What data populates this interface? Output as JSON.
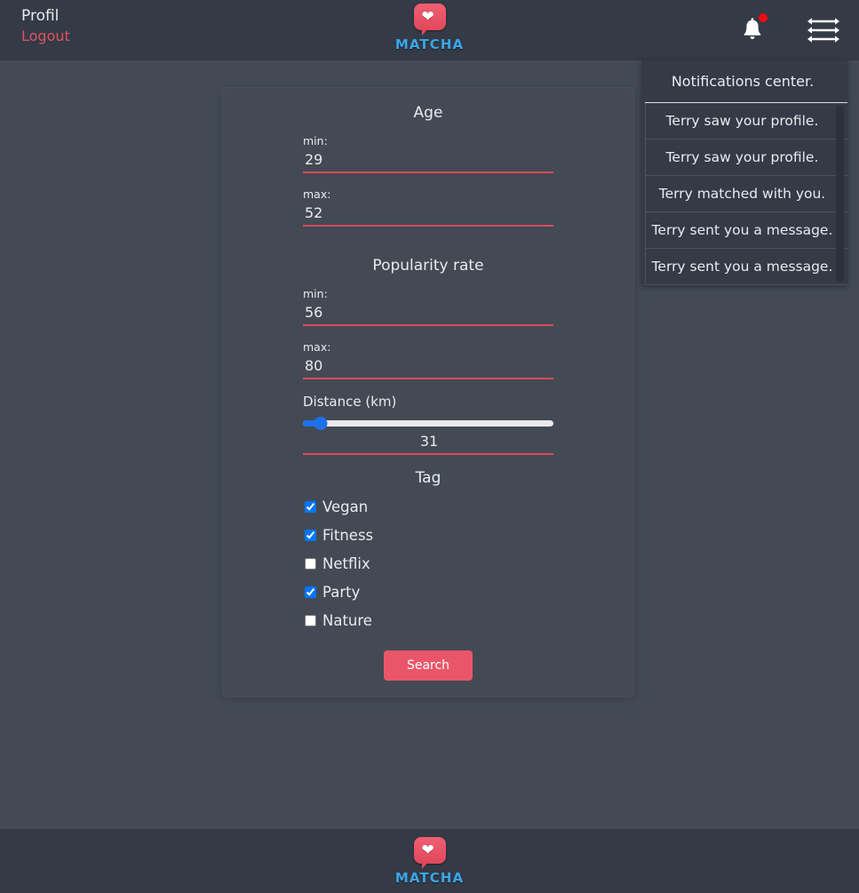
{
  "header": {
    "profile_label": "Profil",
    "logout_label": "Logout",
    "brand_name": "MATCHA",
    "bell_icon": "bell-icon",
    "badge_visible": true,
    "sort_icon": "exchange-arrows-icon"
  },
  "notifications": {
    "title": "Notifications center.",
    "items": [
      {
        "text": "Terry saw your profile."
      },
      {
        "text": "Terry saw your profile."
      },
      {
        "text": "Terry matched with you."
      },
      {
        "text": "Terry sent you a message."
      },
      {
        "text": "Terry sent you a message."
      }
    ]
  },
  "search_form": {
    "age": {
      "title": "Age",
      "min_label": "min:",
      "min_value": "29",
      "max_label": "max:",
      "max_value": "52"
    },
    "popularity": {
      "title": "Popularity rate",
      "min_label": "min:",
      "min_value": "56",
      "max_label": "max:",
      "max_value": "80"
    },
    "distance": {
      "label": "Distance (km)",
      "value": "31",
      "slider_min": "0",
      "slider_max": "500",
      "slider_value": "31",
      "slider_percent": 7
    },
    "tag": {
      "title": "Tag",
      "options": [
        {
          "label": "Vegan",
          "checked": true
        },
        {
          "label": "Fitness",
          "checked": true
        },
        {
          "label": "Netflix",
          "checked": false
        },
        {
          "label": "Party",
          "checked": true
        },
        {
          "label": "Nature",
          "checked": false
        }
      ]
    },
    "submit_label": "Search"
  },
  "footer": {
    "brand_name": "MATCHA"
  },
  "colors": {
    "page_bg": "#434a54",
    "bar_bg": "#343a46",
    "accent_red": "#e9566a",
    "input_underline": "#e0485c",
    "logout_red": "#e05260",
    "brand_blue": "#3aa6e8",
    "slider_blue": "#1e70eb",
    "badge_red": "#ef0b14"
  }
}
